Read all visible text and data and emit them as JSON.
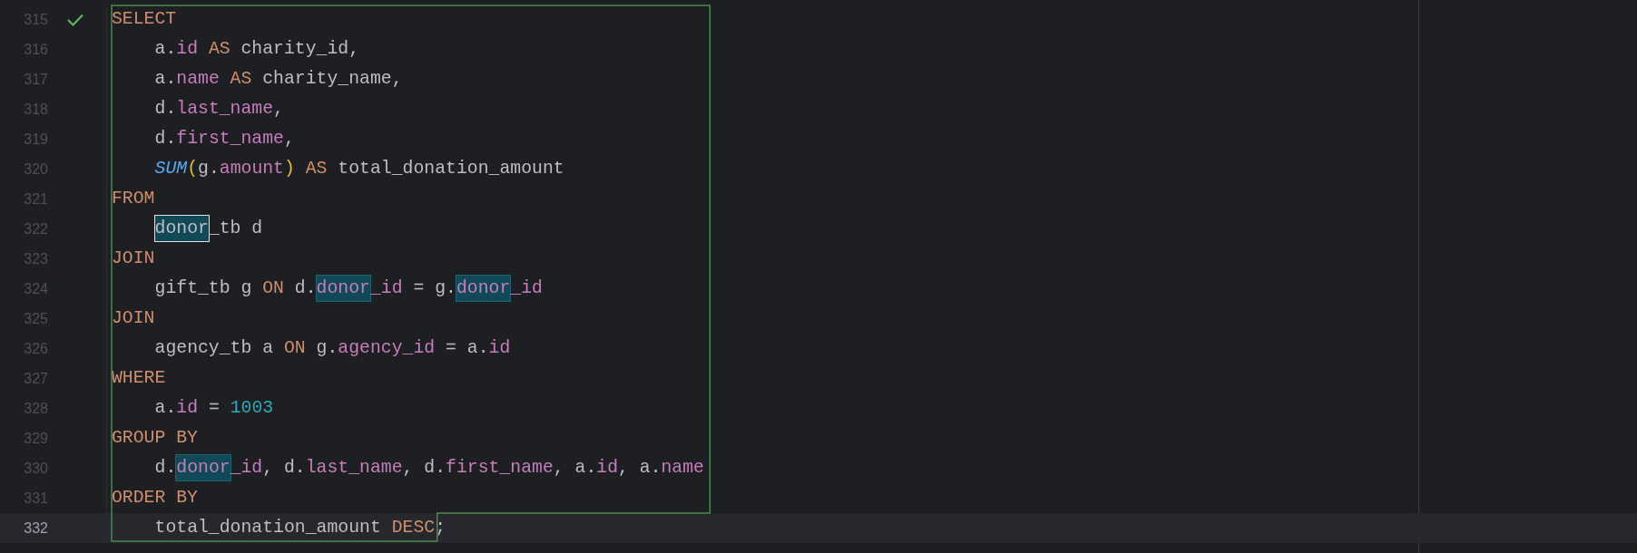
{
  "editor": {
    "lines": [
      {
        "number": "315",
        "current": false,
        "passed": true,
        "indented": false,
        "tokens": [
          {
            "text": "SELECT",
            "kind": "keyword"
          }
        ]
      },
      {
        "number": "316",
        "current": false,
        "indented": true,
        "tokens": [
          {
            "text": "a.",
            "kind": "plain"
          },
          {
            "text": "id",
            "kind": "field"
          },
          {
            "text": " AS ",
            "kind": "keyword"
          },
          {
            "text": "charity_id,",
            "kind": "plain"
          }
        ]
      },
      {
        "number": "317",
        "current": false,
        "indented": true,
        "tokens": [
          {
            "text": "a.",
            "kind": "plain"
          },
          {
            "text": "name",
            "kind": "field"
          },
          {
            "text": " AS ",
            "kind": "keyword"
          },
          {
            "text": "charity_name,",
            "kind": "plain"
          }
        ]
      },
      {
        "number": "318",
        "current": false,
        "indented": true,
        "tokens": [
          {
            "text": "d.",
            "kind": "plain"
          },
          {
            "text": "last_name",
            "kind": "field"
          },
          {
            "text": ",",
            "kind": "plain"
          }
        ]
      },
      {
        "number": "319",
        "current": false,
        "indented": true,
        "tokens": [
          {
            "text": "d.",
            "kind": "plain"
          },
          {
            "text": "first_name",
            "kind": "field"
          },
          {
            "text": ",",
            "kind": "plain"
          }
        ]
      },
      {
        "number": "320",
        "current": false,
        "indented": true,
        "tokens": [
          {
            "text": "SUM",
            "kind": "function"
          },
          {
            "text": "(",
            "kind": "paren"
          },
          {
            "text": "g.",
            "kind": "plain"
          },
          {
            "text": "amount",
            "kind": "field"
          },
          {
            "text": ")",
            "kind": "paren"
          },
          {
            "text": " AS ",
            "kind": "keyword"
          },
          {
            "text": "total_donation_amount",
            "kind": "plain"
          }
        ]
      },
      {
        "number": "321",
        "current": false,
        "indented": false,
        "tokens": [
          {
            "text": "FROM",
            "kind": "keyword"
          }
        ]
      },
      {
        "number": "322",
        "current": false,
        "indented": true,
        "tokens": [
          {
            "text": "donor",
            "kind": "plain",
            "caret": true
          },
          {
            "text": "_tb d",
            "kind": "plain"
          }
        ]
      },
      {
        "number": "323",
        "current": false,
        "indented": false,
        "tokens": [
          {
            "text": "JOIN",
            "kind": "keyword"
          }
        ]
      },
      {
        "number": "324",
        "current": false,
        "indented": true,
        "tokens": [
          {
            "text": "gift_tb g ",
            "kind": "plain"
          },
          {
            "text": "ON",
            "kind": "keyword"
          },
          {
            "text": " d.",
            "kind": "plain"
          },
          {
            "text": "donor",
            "kind": "field",
            "usage": true
          },
          {
            "text": "_id",
            "kind": "field"
          },
          {
            "text": " = g.",
            "kind": "plain"
          },
          {
            "text": "donor",
            "kind": "field",
            "usage": true
          },
          {
            "text": "_id",
            "kind": "field"
          }
        ]
      },
      {
        "number": "325",
        "current": false,
        "indented": false,
        "tokens": [
          {
            "text": "JOIN",
            "kind": "keyword"
          }
        ]
      },
      {
        "number": "326",
        "current": false,
        "indented": true,
        "tokens": [
          {
            "text": "agency_tb a ",
            "kind": "plain"
          },
          {
            "text": "ON",
            "kind": "keyword"
          },
          {
            "text": " g.",
            "kind": "plain"
          },
          {
            "text": "agency_id",
            "kind": "field"
          },
          {
            "text": " = a.",
            "kind": "plain"
          },
          {
            "text": "id",
            "kind": "field"
          }
        ]
      },
      {
        "number": "327",
        "current": false,
        "indented": false,
        "tokens": [
          {
            "text": "WHERE",
            "kind": "keyword"
          }
        ]
      },
      {
        "number": "328",
        "current": false,
        "indented": true,
        "tokens": [
          {
            "text": "a.",
            "kind": "plain"
          },
          {
            "text": "id",
            "kind": "field"
          },
          {
            "text": " = ",
            "kind": "plain"
          },
          {
            "text": "1003",
            "kind": "number"
          }
        ]
      },
      {
        "number": "329",
        "current": false,
        "indented": false,
        "tokens": [
          {
            "text": "GROUP BY",
            "kind": "keyword"
          }
        ]
      },
      {
        "number": "330",
        "current": false,
        "indented": true,
        "tokens": [
          {
            "text": "d.",
            "kind": "plain"
          },
          {
            "text": "donor",
            "kind": "field",
            "usage": true
          },
          {
            "text": "_id",
            "kind": "field"
          },
          {
            "text": ", d.",
            "kind": "plain"
          },
          {
            "text": "last_name",
            "kind": "field"
          },
          {
            "text": ", d.",
            "kind": "plain"
          },
          {
            "text": "first_name",
            "kind": "field"
          },
          {
            "text": ", a.",
            "kind": "plain"
          },
          {
            "text": "id",
            "kind": "field"
          },
          {
            "text": ", a.",
            "kind": "plain"
          },
          {
            "text": "name",
            "kind": "field"
          }
        ]
      },
      {
        "number": "331",
        "current": false,
        "indented": false,
        "tokens": [
          {
            "text": "ORDER BY",
            "kind": "keyword"
          }
        ]
      },
      {
        "number": "332",
        "current": true,
        "indented": true,
        "tokens": [
          {
            "text": "total_donation_amount ",
            "kind": "plain"
          },
          {
            "text": "DESC",
            "kind": "keyword"
          },
          {
            "text": ";",
            "kind": "plain"
          }
        ]
      }
    ]
  }
}
